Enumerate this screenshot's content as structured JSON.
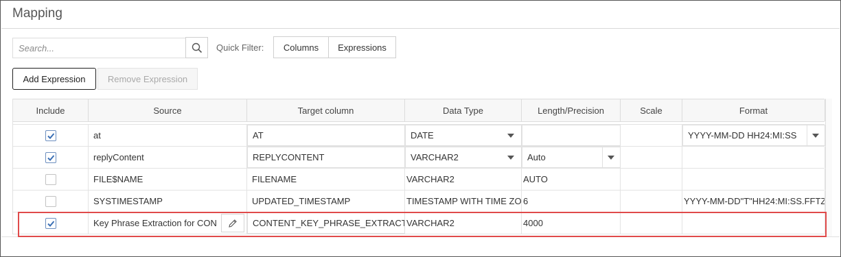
{
  "panel": {
    "title": "Mapping"
  },
  "toolbar": {
    "search_placeholder": "Search...",
    "search_icon": "search-icon",
    "quick_filter_label": "Quick Filter:",
    "filters": [
      "Columns",
      "Expressions"
    ],
    "add_expression": "Add Expression",
    "remove_expression": "Remove Expression"
  },
  "table": {
    "headers": [
      "Include",
      "Source",
      "Target column",
      "Data Type",
      "Length/Precision",
      "Scale",
      "Format"
    ],
    "rows": [
      {
        "include": true,
        "source": "at",
        "target": "AT",
        "data_type": "DATE",
        "length": "",
        "scale": "",
        "format": "YYYY-MM-DD HH24:MI:SS"
      },
      {
        "include": true,
        "source": "replyContent",
        "target": "REPLYCONTENT",
        "data_type": "VARCHAR2",
        "length": "Auto",
        "scale": "",
        "format": ""
      },
      {
        "include": false,
        "source": "FILE$NAME",
        "target": "FILENAME",
        "data_type": "VARCHAR2",
        "length": "AUTO",
        "scale": "",
        "format": ""
      },
      {
        "include": false,
        "source": "SYSTIMESTAMP",
        "target": "UPDATED_TIMESTAMP",
        "data_type": "TIMESTAMP WITH TIME ZO",
        "length": "6",
        "scale": "",
        "format": "YYYY-MM-DD\"T\"HH24:MI:SS.FFTZ"
      },
      {
        "include": true,
        "source": "Key Phrase Extraction for CON",
        "target": "CONTENT_KEY_PHRASE_EXTRACTIC",
        "data_type": "VARCHAR2",
        "length": "4000",
        "scale": "",
        "format": ""
      }
    ]
  },
  "colors": {
    "highlight": "#e04a4a",
    "checkbox_check": "#3a6fb5"
  }
}
